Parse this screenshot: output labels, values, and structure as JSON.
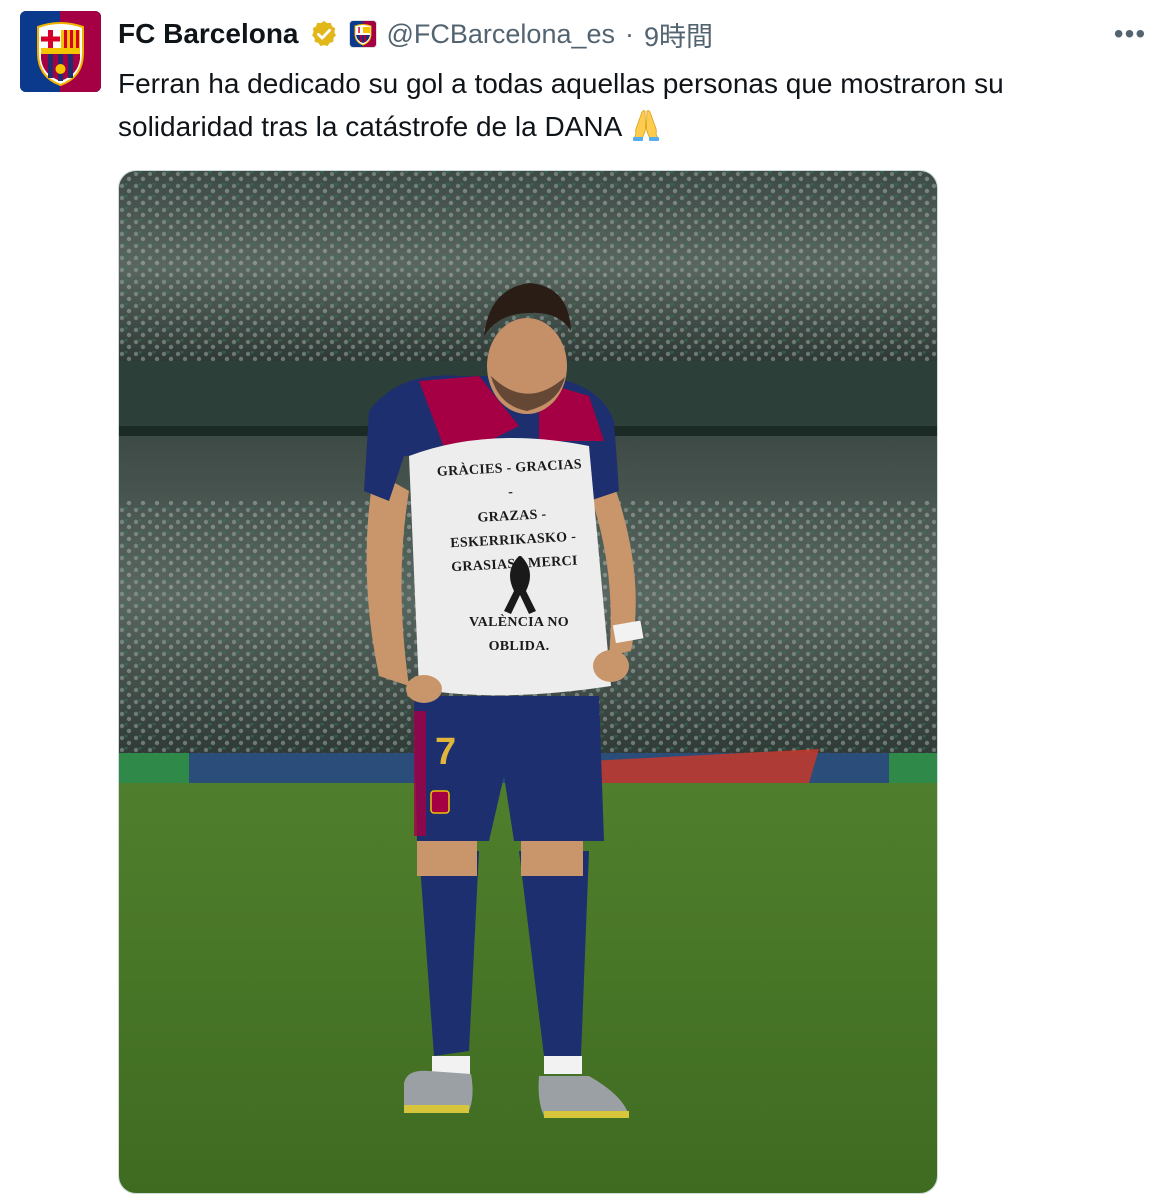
{
  "account": {
    "display_name": "FC Barcelona",
    "handle": "@FCBarcelona_es",
    "separator": "·",
    "timestamp": "9時間",
    "verified_icon": "verified-gold-badge",
    "affiliate_icon": "fcb-crest-badge",
    "avatar_icon": "fcb-crest"
  },
  "tweet": {
    "text": "Ferran ha dedicado su gol a todas aquellas personas que mostraron su solidaridad tras la catástrofe de la DANA",
    "emoji": "folded-hands-emoji"
  },
  "menu": {
    "more_label": "•••"
  },
  "media": {
    "shirt_lines": [
      "GRÀCIES - GRACIAS -",
      "GRAZAS -",
      "ESKERRIKASKO -",
      "GRASIAS - MERCI",
      "VALÈNCIA NO",
      "OBLIDA."
    ],
    "shorts_number": "7"
  },
  "colors": {
    "text": "#0f1419",
    "muted": "#536471",
    "blaugrana_blue": "#1d2f6f",
    "blaugrana_red": "#a50044",
    "verified_gold": "#e2b719"
  }
}
